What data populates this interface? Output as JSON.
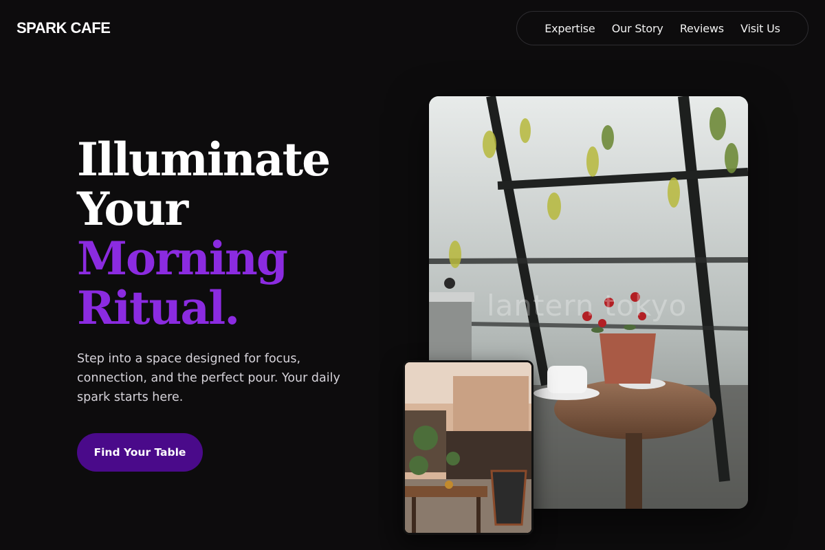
{
  "brand": {
    "name": "SPARK CAFE"
  },
  "nav": {
    "items": [
      "Expertise",
      "Our Story",
      "Reviews",
      "Visit Us"
    ]
  },
  "hero": {
    "line1": "Illuminate",
    "line2": "Your",
    "line3": "Morning",
    "line4": "Ritual.",
    "subtitle": "Step into a space designed for focus, connection, and the perfect pour. Your daily spark starts here.",
    "cta_label": "Find Your Table"
  },
  "images": {
    "main_watermark": "lantern tokyo"
  },
  "colors": {
    "background": "#0d0c0d",
    "accent": "#8b2be0",
    "button": "#4a0a8a"
  }
}
